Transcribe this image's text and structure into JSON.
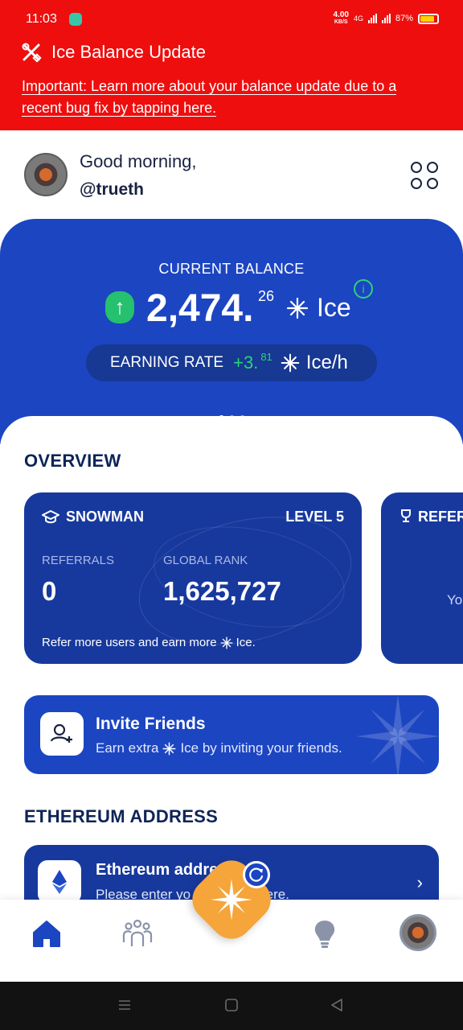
{
  "status_bar": {
    "time": "11:03",
    "net_speed_value": "4.00",
    "net_speed_unit": "KB/S",
    "network_type": "4G",
    "battery": "87%"
  },
  "alert": {
    "title": "Ice Balance Update",
    "body": "Important: Learn more about your balance update due to a recent bug fix by tapping here."
  },
  "greeting": {
    "line1": "Good morning,",
    "username": "@trueth"
  },
  "balance": {
    "label": "CURRENT BALANCE",
    "whole": "2,474.",
    "decimal": "26",
    "unit": "Ice",
    "rate_label": "EARNING RATE",
    "rate_whole": "+3.",
    "rate_decimal": "81",
    "rate_unit": "Ice/h",
    "carousel_pages": 3,
    "carousel_active": 0
  },
  "overview": {
    "title": "OVERVIEW",
    "level_card": {
      "name": "SNOWMAN",
      "level": "LEVEL 5",
      "referrals_label": "REFERRALS",
      "referrals_value": "0",
      "rank_label": "GLOBAL RANK",
      "rank_value": "1,625,727",
      "footer_pre": "Refer more users and earn more",
      "footer_post": "Ice."
    },
    "next_card": {
      "title": "REFERR",
      "body": "Yo"
    }
  },
  "invite": {
    "title": "Invite Friends",
    "subtitle_pre": "Earn extra",
    "subtitle_post": "Ice by inviting your friends."
  },
  "ethereum": {
    "section_title": "ETHEREUM ADDRESS",
    "card_title": "Ethereum addre",
    "card_subtitle": "Please enter yo                n address here."
  },
  "colors": {
    "alert_red": "#ee0e0e",
    "primary_blue": "#1c45c2",
    "dark_blue": "#17399e",
    "positive_green": "#2bd37b",
    "mining_orange": "#f5a53a"
  },
  "icons": {
    "alert": "tools-icon",
    "menu": "four-dots-grid-icon",
    "nav": [
      "home-icon",
      "team-icon",
      "mining-button-icon",
      "tips-bulb-icon",
      "profile-avatar"
    ]
  }
}
